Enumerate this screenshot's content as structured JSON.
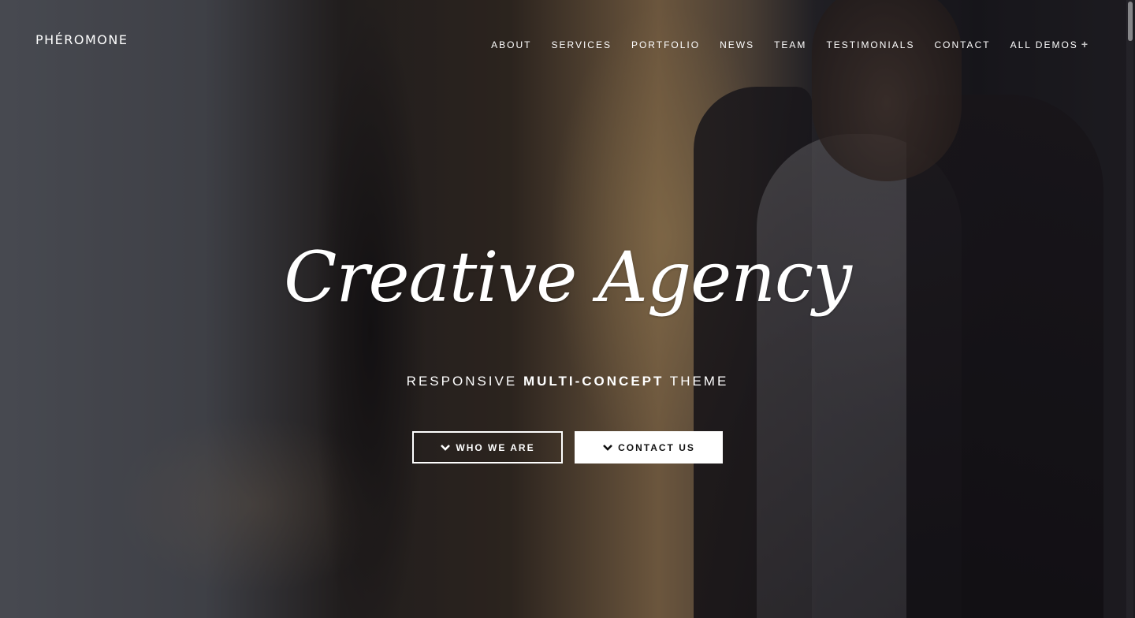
{
  "brand": {
    "name": "PHÉROMONE"
  },
  "nav": {
    "items": [
      {
        "label": "ABOUT"
      },
      {
        "label": "SERVICES"
      },
      {
        "label": "PORTFOLIO"
      },
      {
        "label": "NEWS"
      },
      {
        "label": "TEAM"
      },
      {
        "label": "TESTIMONIALS"
      },
      {
        "label": "CONTACT"
      },
      {
        "label": "ALL DEMOS",
        "icon": "plus-icon"
      }
    ]
  },
  "hero": {
    "title": "Creative Agency",
    "subtitle_pre": "RESPONSIVE ",
    "subtitle_bold": "MULTI-CONCEPT",
    "subtitle_post": " THEME",
    "buttons": {
      "primary": {
        "label": "WHO WE ARE",
        "icon": "chevron-down-icon"
      },
      "secondary": {
        "label": "CONTACT US",
        "icon": "chevron-down-icon"
      }
    }
  },
  "colors": {
    "text": "#ffffff",
    "button_solid_bg": "#ffffff",
    "button_solid_text": "#111111"
  }
}
